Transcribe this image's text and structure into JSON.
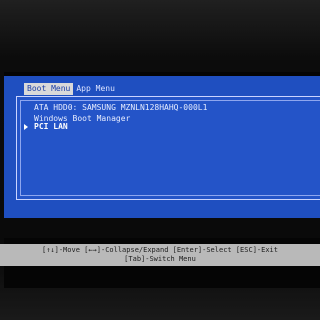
{
  "tabs": [
    {
      "label": "Boot Menu",
      "active": true
    },
    {
      "label": "App Menu",
      "active": false
    }
  ],
  "boot_entries": [
    {
      "label": "ATA HDD0: SAMSUNG MZNLN128HAHQ-000L1",
      "selected": false
    },
    {
      "label": "Windows Boot Manager",
      "selected": false
    },
    {
      "label": "PCI LAN",
      "selected": true
    }
  ],
  "selection_marker_icon": "triangle-right-icon",
  "help": {
    "line1": "[↑↓]-Move [←→]-Collapse/Expand [Enter]-Select [ESC]-Exit",
    "line2": "[Tab]-Switch Menu"
  },
  "colors": {
    "menu_background": "#1f4fc0",
    "help_bar_background": "#b9b9b9",
    "text": "#e6ecff"
  }
}
